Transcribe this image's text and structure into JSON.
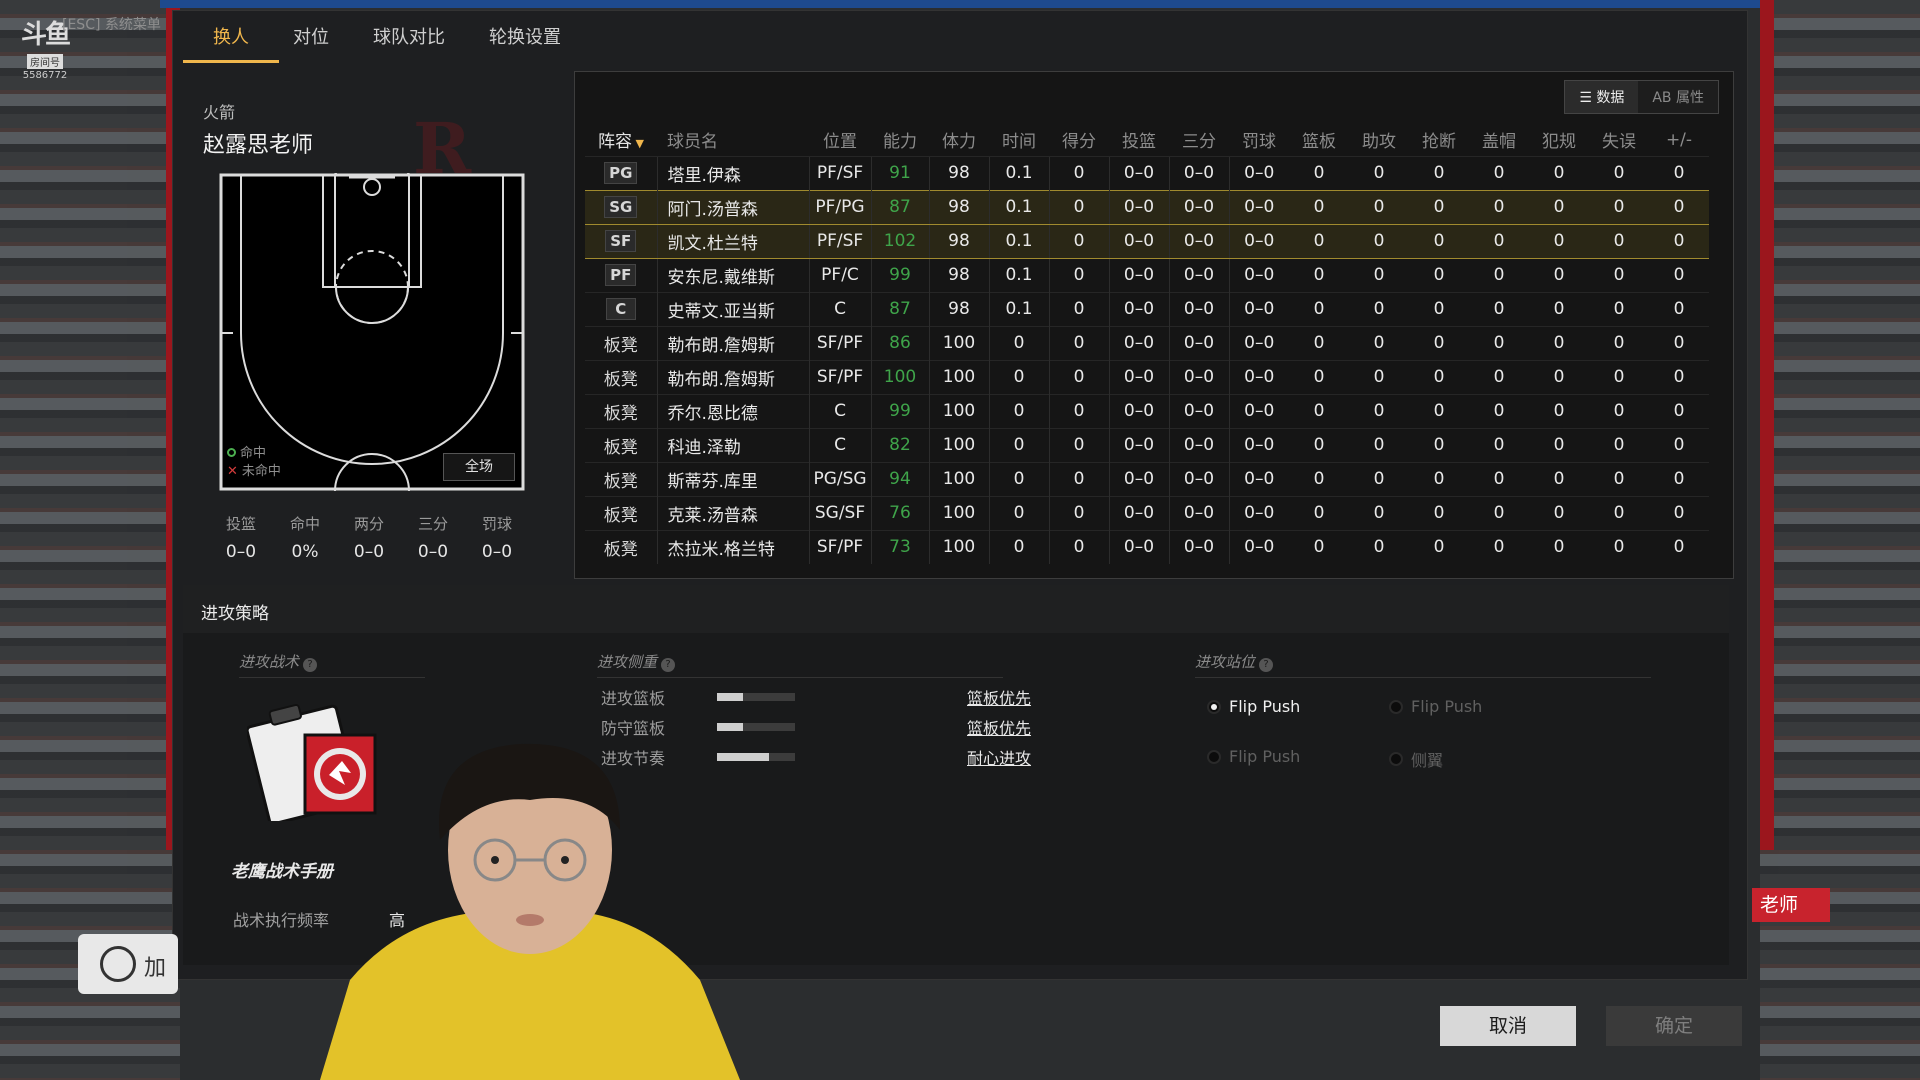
{
  "stream": {
    "esc_hint": "[ESC] 系统菜单",
    "logo_text": "斗鱼",
    "logo_sub": "房间号",
    "room_number": "5586772"
  },
  "tabs": [
    {
      "label": "换人",
      "active": true
    },
    {
      "label": "对位",
      "active": false
    },
    {
      "label": "球队对比",
      "active": false
    },
    {
      "label": "轮换设置",
      "active": false
    }
  ],
  "team": {
    "name": "火箭",
    "coach": "赵露思老师",
    "watermark": "HOUSTON ROCKETS"
  },
  "court": {
    "legend_made": "命中",
    "legend_miss": "未命中",
    "full_court_button": "全场"
  },
  "shot_summary": [
    {
      "label": "投篮",
      "value": "0–0"
    },
    {
      "label": "命中",
      "value": "0%"
    },
    {
      "label": "两分",
      "value": "0–0"
    },
    {
      "label": "三分",
      "value": "0–0"
    },
    {
      "label": "罚球",
      "value": "0–0"
    }
  ],
  "view_toggle": {
    "data_label": "数据",
    "attr_label": "AB 属性"
  },
  "stats": {
    "headers": [
      "阵容",
      "球员名",
      "位置",
      "能力",
      "体力",
      "时间",
      "得分",
      "投篮",
      "三分",
      "罚球",
      "篮板",
      "助攻",
      "抢断",
      "盖帽",
      "犯规",
      "失误",
      "+/-"
    ],
    "rows": [
      {
        "role": "PG",
        "badge": true,
        "name": "塔里.伊森",
        "pos": "PF/SF",
        "ovr": "91",
        "sta": "98",
        "min": "0.1",
        "pts": "0",
        "fg": "0–0",
        "tp": "0–0",
        "ft": "0–0",
        "reb": "0",
        "ast": "0",
        "stl": "0",
        "blk": "0",
        "pf": "0",
        "to": "0",
        "pm": "0",
        "selected": false
      },
      {
        "role": "SG",
        "badge": true,
        "name": "阿门.汤普森",
        "pos": "PF/PG",
        "ovr": "87",
        "sta": "98",
        "min": "0.1",
        "pts": "0",
        "fg": "0–0",
        "tp": "0–0",
        "ft": "0–0",
        "reb": "0",
        "ast": "0",
        "stl": "0",
        "blk": "0",
        "pf": "0",
        "to": "0",
        "pm": "0",
        "selected": true
      },
      {
        "role": "SF",
        "badge": true,
        "name": "凯文.杜兰特",
        "pos": "PF/SF",
        "ovr": "102",
        "sta": "98",
        "min": "0.1",
        "pts": "0",
        "fg": "0–0",
        "tp": "0–0",
        "ft": "0–0",
        "reb": "0",
        "ast": "0",
        "stl": "0",
        "blk": "0",
        "pf": "0",
        "to": "0",
        "pm": "0",
        "selected": true
      },
      {
        "role": "PF",
        "badge": true,
        "name": "安东尼.戴维斯",
        "pos": "PF/C",
        "ovr": "99",
        "sta": "98",
        "min": "0.1",
        "pts": "0",
        "fg": "0–0",
        "tp": "0–0",
        "ft": "0–0",
        "reb": "0",
        "ast": "0",
        "stl": "0",
        "blk": "0",
        "pf": "0",
        "to": "0",
        "pm": "0",
        "selected": false
      },
      {
        "role": "C",
        "badge": true,
        "name": "史蒂文.亚当斯",
        "pos": "C",
        "ovr": "87",
        "sta": "98",
        "min": "0.1",
        "pts": "0",
        "fg": "0–0",
        "tp": "0–0",
        "ft": "0–0",
        "reb": "0",
        "ast": "0",
        "stl": "0",
        "blk": "0",
        "pf": "0",
        "to": "0",
        "pm": "0",
        "selected": false
      },
      {
        "role": "板凳",
        "badge": false,
        "name": "勒布朗.詹姆斯",
        "pos": "SF/PF",
        "ovr": "86",
        "sta": "100",
        "min": "0",
        "pts": "0",
        "fg": "0–0",
        "tp": "0–0",
        "ft": "0–0",
        "reb": "0",
        "ast": "0",
        "stl": "0",
        "blk": "0",
        "pf": "0",
        "to": "0",
        "pm": "0",
        "selected": false
      },
      {
        "role": "板凳",
        "badge": false,
        "name": "勒布朗.詹姆斯",
        "pos": "SF/PF",
        "ovr": "100",
        "sta": "100",
        "min": "0",
        "pts": "0",
        "fg": "0–0",
        "tp": "0–0",
        "ft": "0–0",
        "reb": "0",
        "ast": "0",
        "stl": "0",
        "blk": "0",
        "pf": "0",
        "to": "0",
        "pm": "0",
        "selected": false
      },
      {
        "role": "板凳",
        "badge": false,
        "name": "乔尔.恩比德",
        "pos": "C",
        "ovr": "99",
        "sta": "100",
        "min": "0",
        "pts": "0",
        "fg": "0–0",
        "tp": "0–0",
        "ft": "0–0",
        "reb": "0",
        "ast": "0",
        "stl": "0",
        "blk": "0",
        "pf": "0",
        "to": "0",
        "pm": "0",
        "selected": false
      },
      {
        "role": "板凳",
        "badge": false,
        "name": "科迪.泽勒",
        "pos": "C",
        "ovr": "82",
        "sta": "100",
        "min": "0",
        "pts": "0",
        "fg": "0–0",
        "tp": "0–0",
        "ft": "0–0",
        "reb": "0",
        "ast": "0",
        "stl": "0",
        "blk": "0",
        "pf": "0",
        "to": "0",
        "pm": "0",
        "selected": false
      },
      {
        "role": "板凳",
        "badge": false,
        "name": "斯蒂芬.库里",
        "pos": "PG/SG",
        "ovr": "94",
        "sta": "100",
        "min": "0",
        "pts": "0",
        "fg": "0–0",
        "tp": "0–0",
        "ft": "0–0",
        "reb": "0",
        "ast": "0",
        "stl": "0",
        "blk": "0",
        "pf": "0",
        "to": "0",
        "pm": "0",
        "selected": false
      },
      {
        "role": "板凳",
        "badge": false,
        "name": "克莱.汤普森",
        "pos": "SG/SF",
        "ovr": "76",
        "sta": "100",
        "min": "0",
        "pts": "0",
        "fg": "0–0",
        "tp": "0–0",
        "ft": "0–0",
        "reb": "0",
        "ast": "0",
        "stl": "0",
        "blk": "0",
        "pf": "0",
        "to": "0",
        "pm": "0",
        "selected": false
      },
      {
        "role": "板凳",
        "badge": false,
        "name": "杰拉米.格兰特",
        "pos": "SF/PF",
        "ovr": "73",
        "sta": "100",
        "min": "0",
        "pts": "0",
        "fg": "0–0",
        "tp": "0–0",
        "ft": "0–0",
        "reb": "0",
        "ast": "0",
        "stl": "0",
        "blk": "0",
        "pf": "0",
        "to": "0",
        "pm": "0",
        "selected": false
      }
    ]
  },
  "strategy": {
    "title": "进攻策略",
    "tactics_label": "进攻战术",
    "playbook_name": "老鹰战术手册",
    "freq_label": "战术执行频率",
    "freq_value": "高",
    "focus_label": "进攻侧重",
    "sliders": [
      {
        "label": "进攻篮板",
        "level": 0.33,
        "pick": "篮板优先"
      },
      {
        "label": "防守篮板",
        "level": 0.33,
        "pick": "篮板优先"
      },
      {
        "label": "进攻节奏",
        "level": 0.67,
        "pick": "耐心进攻"
      }
    ],
    "formation_label": "进攻站位",
    "formations": [
      {
        "label": "Flip Push",
        "selected": true
      },
      {
        "label": "Flip Push",
        "selected": false
      },
      {
        "label": "Flip Push",
        "selected": false
      },
      {
        "label": "侧翼",
        "selected": false
      }
    ]
  },
  "buttons": {
    "cancel": "取消",
    "confirm": "确定"
  },
  "side_tag": "老师",
  "left_chip_text": "加",
  "colors": {
    "accent": "#f0b64c",
    "ability_green": "#3fa44a",
    "team_red": "#c8232d"
  }
}
